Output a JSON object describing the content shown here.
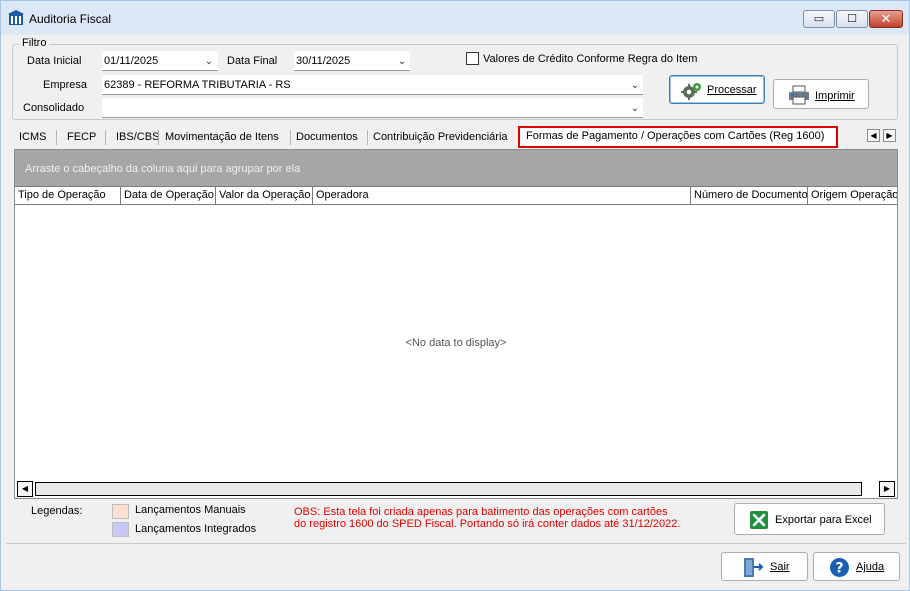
{
  "window": {
    "title": "Auditoria Fiscal",
    "min_glyph": "▭",
    "max_glyph": "☐",
    "close_glyph": "✕"
  },
  "filter": {
    "legend": "Filtro",
    "data_inicial_label": "Data Inicial",
    "data_inicial_value": "01/11/2025",
    "data_final_label": "Data Final",
    "data_final_value": "30/11/2025",
    "checkbox_label": "Valores de Crédito Conforme Regra do Item",
    "checkbox_checked": false,
    "empresa_label": "Empresa",
    "empresa_value": "62389 - REFORMA TRIBUTARIA - RS",
    "consolidado_label": "Consolidado",
    "consolidado_value": ""
  },
  "buttons": {
    "processar": "Processar",
    "imprimir": "Imprimir",
    "exportar": "Exportar para Excel",
    "sair": "Sair",
    "ajuda": "Ajuda"
  },
  "tabs": [
    {
      "label": "ICMS"
    },
    {
      "label": "FECP"
    },
    {
      "label": "IBS/CBS"
    },
    {
      "label": "Movimentação de Itens"
    },
    {
      "label": "Documentos"
    },
    {
      "label": "Contribuição Previdenciária"
    },
    {
      "label": "Formas de Pagamento / Operações com Cartões  (Reg 1600)",
      "active": true
    }
  ],
  "tab_nav": {
    "prev": "◀",
    "next": "▶"
  },
  "grid": {
    "group_hint": "Arraste o cabeçalho da coluna aqui para agrupar por ela",
    "columns": [
      "Tipo de Operação",
      "Data de Operação",
      "Valor da Operação",
      "Operadora",
      "Número de Documento",
      "Origem Operação"
    ],
    "rows": [],
    "empty_text": "<No data to display>",
    "scroll_left": "◀",
    "scroll_right": "▶"
  },
  "legend": {
    "title": "Legendas:",
    "items": [
      {
        "label": "Lançamentos Manuais",
        "color": "#fde0d0"
      },
      {
        "label": "Lançamentos Integrados",
        "color": "#c8c8f5"
      }
    ]
  },
  "obs": {
    "line1": "OBS: Esta tela foi criada apenas para batimento das operações com  cartões",
    "line2": "do registro 1600 do SPED Fiscal. Portando só irá conter dados até 31/12/2022."
  },
  "colors": {
    "highlight": "#e00000",
    "group_panel": "#a6a6a6",
    "excel_green": "#1f8f3c",
    "help_blue": "#1a5fb4"
  },
  "icons": [
    "app-icon",
    "gears-icon",
    "printer-icon",
    "excel-icon",
    "exit-door-icon",
    "help-icon",
    "chevron-down-icon"
  ]
}
